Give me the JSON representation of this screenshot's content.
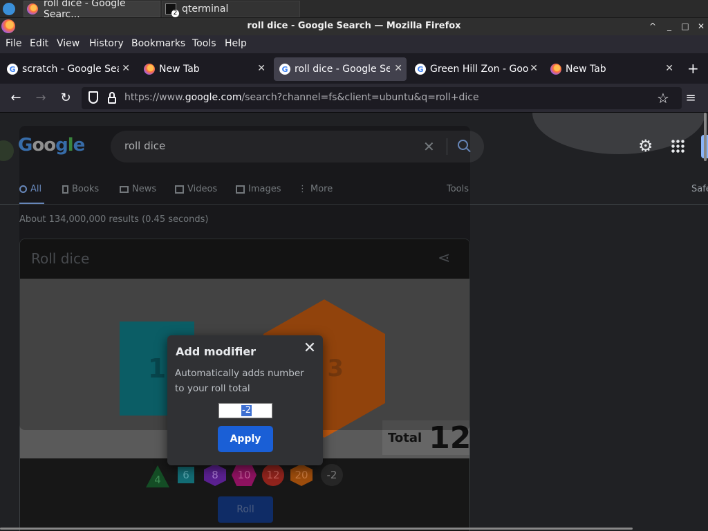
{
  "taskbar": {
    "tasks": [
      {
        "label": "roll dice - Google Searc..."
      },
      {
        "label": "qterminal",
        "badge": "2"
      }
    ]
  },
  "window": {
    "title": "roll dice - Google Search — Mozilla Firefox",
    "controls": [
      "^",
      "_",
      "□",
      "✕"
    ]
  },
  "menubar": {
    "items": [
      "File",
      "Edit",
      "View",
      "History",
      "Bookmarks",
      "Tools",
      "Help"
    ]
  },
  "tabs": [
    {
      "label": "scratch - Google Search",
      "favicon": "google"
    },
    {
      "label": "New Tab",
      "favicon": "firefox"
    },
    {
      "label": "roll dice - Google Search",
      "favicon": "google",
      "selected": true
    },
    {
      "label": "Green Hill Zon - Google Search",
      "favicon": "google"
    },
    {
      "label": "New Tab",
      "favicon": "firefox"
    }
  ],
  "navbar": {
    "url_prefix": "https://www.",
    "url_domain": "google.com",
    "url_rest": "/search?channel=fs&client=ubuntu&q=roll+dice"
  },
  "google": {
    "query": "roll dice",
    "tabs": [
      "All",
      "Books",
      "News",
      "Videos",
      "Images",
      "More"
    ],
    "tools_label": "Tools",
    "safe_label": "Safe",
    "stats": "About 134,000,000 results (0.45 seconds)"
  },
  "card": {
    "title": "Roll dice",
    "die_left_value": "1",
    "die_right_value": "3",
    "total_label": "Total",
    "total_value": "12",
    "dice_buttons": [
      "4",
      "6",
      "8",
      "10",
      "12",
      "20",
      "-2"
    ],
    "roll_label": "Roll"
  },
  "modal": {
    "title": "Add modifier",
    "close_symbol": "✕",
    "description": "Automatically adds number to your roll total",
    "input_value": "-2",
    "apply_label": "Apply"
  },
  "colors": {
    "accent": "#8ab4f8",
    "apply_button": "#1a5fd6",
    "d4": "#1e8e3e",
    "d6": "#1a9ba7",
    "d8": "#8430ce",
    "d10": "#d01884",
    "d12": "#d93025",
    "d20": "#e8710a"
  }
}
